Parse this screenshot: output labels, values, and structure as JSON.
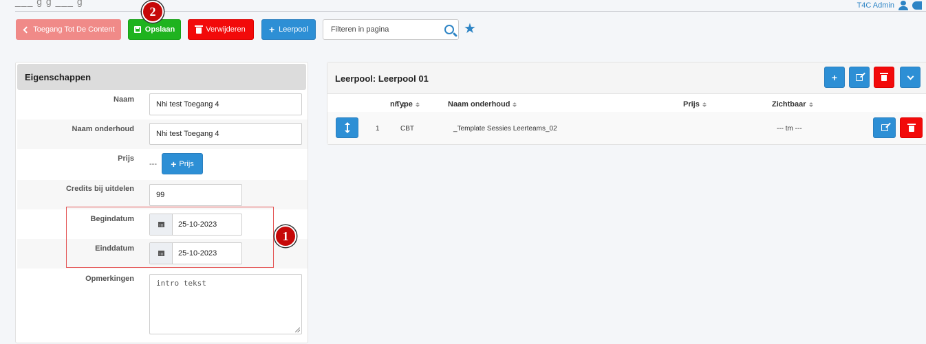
{
  "header": {
    "title_fragment": "___ g   g         ___   g",
    "user_name": "T4C Admin"
  },
  "toolbar": {
    "back_label": "Toegang Tot De Content",
    "save_label": "Opslaan",
    "delete_label": "Verwijderen",
    "add_pool_label": "Leerpool",
    "filter_placeholder": "Filteren in pagina"
  },
  "annotations": {
    "marker_1": "1",
    "marker_2": "2"
  },
  "properties": {
    "title": "Eigenschappen",
    "fields": {
      "naam_label": "Naam",
      "naam_value": "Nhi test Toegang 4",
      "naam_onderhoud_label": "Naam onderhoud",
      "naam_onderhoud_value": "Nhi test Toegang 4",
      "prijs_label": "Prijs",
      "prijs_value": "---",
      "prijs_button": "Prijs",
      "credits_label": "Credits bij uitdelen",
      "credits_value": "99",
      "begindatum_label": "Begindatum",
      "begindatum_value": "25-10-2023",
      "einddatum_label": "Einddatum",
      "einddatum_value": "25-10-2023",
      "opmerkingen_label": "Opmerkingen",
      "opmerkingen_placeholder": "intro tekst"
    }
  },
  "leerpool": {
    "title": "Leerpool: Leerpool 01",
    "columns": {
      "nr": "nr.",
      "type": "Type",
      "naam_onderhoud": "Naam onderhoud",
      "prijs": "Prijs",
      "zichtbaar": "Zichtbaar"
    },
    "rows": [
      {
        "nr": "1",
        "type": "CBT",
        "naam_onderhoud": "_Template Sessies Leerteams_02",
        "prijs": "",
        "zichtbaar": "--- tm ---"
      }
    ]
  },
  "colors": {
    "primary": "#2d8fd5",
    "success": "#1fb31f",
    "danger": "#f20a0a",
    "back": "#f08a88",
    "marker": "#c60808"
  }
}
